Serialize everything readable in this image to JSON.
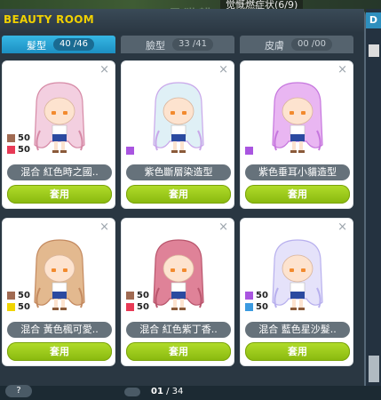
{
  "window": {
    "title": "BEAUTY ROOM"
  },
  "background": {
    "ghost_text": "星猫耕",
    "overlay_text": "觉慨燃症状(6/9)"
  },
  "side_panel": {
    "label": "D"
  },
  "tabs": [
    {
      "label": "髮型",
      "count": "40 /46",
      "active": true
    },
    {
      "label": "臉型",
      "count": "33 /41",
      "active": false
    },
    {
      "label": "皮膚",
      "count": "00 /00",
      "active": false
    }
  ],
  "cards": [
    {
      "name": "混合 紅色時之國..",
      "apply": "套用",
      "swatches": [
        {
          "color": "#a06a52",
          "value": "50"
        },
        {
          "color": "#e83a56",
          "value": "50"
        }
      ],
      "hair": "#f3cfe0",
      "hair2": "#d68aa6",
      "single": false
    },
    {
      "name": "紫色斷層染造型",
      "apply": "套用",
      "swatches": [
        {
          "color": "#a955e0",
          "value": ""
        }
      ],
      "hair": "#dff0f6",
      "hair2": "#c9a7ea",
      "single": true
    },
    {
      "name": "紫色垂耳小貓造型",
      "apply": "套用",
      "swatches": [
        {
          "color": "#a955e0",
          "value": ""
        }
      ],
      "hair": "#e9b6f2",
      "hair2": "#c677de",
      "single": true
    },
    {
      "name": "混合 黃色楓可愛..",
      "apply": "套用",
      "swatches": [
        {
          "color": "#a06a52",
          "value": "50"
        },
        {
          "color": "#f0d400",
          "value": "50"
        }
      ],
      "hair": "#e3b98f",
      "hair2": "#c48a60",
      "single": false
    },
    {
      "name": "混合 紅色紫丁香..",
      "apply": "套用",
      "swatches": [
        {
          "color": "#a06a52",
          "value": "50"
        },
        {
          "color": "#e83a56",
          "value": "50"
        }
      ],
      "hair": "#df8298",
      "hair2": "#b9566d",
      "single": false
    },
    {
      "name": "混合 藍色星沙髮..",
      "apply": "套用",
      "swatches": [
        {
          "color": "#a955e0",
          "value": "50"
        },
        {
          "color": "#3b9ae0",
          "value": "50"
        }
      ],
      "hair": "#e5e2fa",
      "hair2": "#b8b0ee",
      "single": false
    }
  ],
  "footer": {
    "help_label": "?",
    "page_current": "01",
    "page_total": "/ 34"
  },
  "icons": {
    "close": "close-icon",
    "prev": "prev-page-icon"
  }
}
